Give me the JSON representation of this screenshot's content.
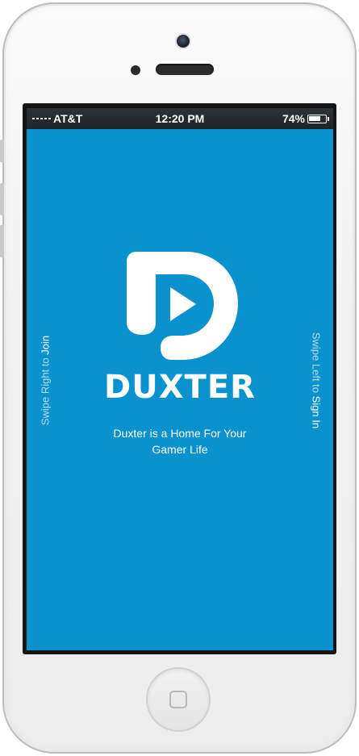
{
  "status_bar": {
    "carrier": "AT&T",
    "time": "12:20 PM",
    "battery_percent_label": "74%",
    "battery_level": 0.74
  },
  "splash": {
    "brand_name": "DUXTER",
    "tagline_line1": "Duxter is a Home For Your",
    "tagline_line2": "Gamer Life",
    "swipe_right_prefix": "Swipe Right to ",
    "swipe_right_action": "Join",
    "swipe_left_prefix": "Swipe Left to ",
    "swipe_left_action": "Sign In"
  },
  "colors": {
    "background": "#0a92cf",
    "logo": "#ffffff",
    "hint_text": "#b4def2"
  },
  "icons": {
    "logo": "duxter-play-logo-icon",
    "signal": "signal-strength-icon",
    "battery": "battery-icon",
    "home": "home-button-icon"
  }
}
